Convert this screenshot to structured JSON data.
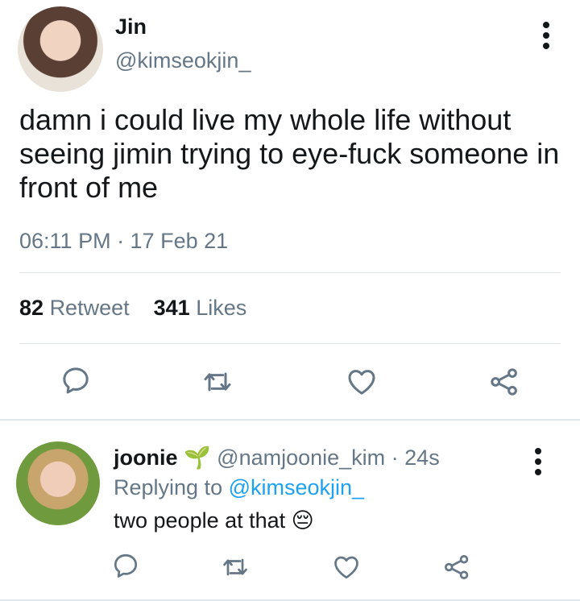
{
  "tweet": {
    "author": {
      "name": "Jin",
      "handle": "@kimseokjin_"
    },
    "text": "damn i could live my whole life without seeing jimin trying to eye-fuck someone in front of me",
    "timestamp": "06:11 PM · 17 Feb 21",
    "stats": {
      "retweets_count": "82",
      "retweets_label": "Retweet",
      "likes_count": "341",
      "likes_label": "Likes"
    },
    "actions": [
      "reply-icon",
      "retweet-icon",
      "like-icon",
      "share-icon"
    ]
  },
  "reply": {
    "author": {
      "name": "joonie",
      "emoji": "🌱",
      "handle": "@namjoonie_kim",
      "age": "· 24s"
    },
    "replying_prefix": "Replying to",
    "replying_to": "@kimseokjin_",
    "text": "two people at that",
    "text_emoji": "😔",
    "actions": [
      "reply-icon",
      "retweet-icon",
      "like-icon",
      "share-icon"
    ]
  },
  "colors": {
    "text": "#14171a",
    "secondary": "#657786",
    "link": "#1da1f2",
    "divider": "#e1e8ed"
  }
}
